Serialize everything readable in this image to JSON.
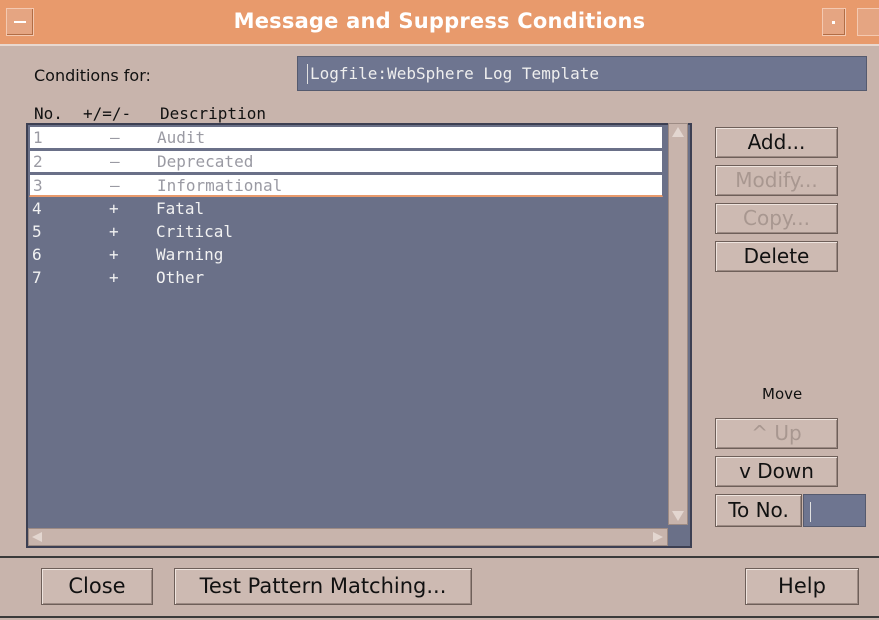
{
  "window": {
    "title": "Message and Suppress Conditions",
    "title_color": "#e89a6c",
    "background_color": "#c8b4ac"
  },
  "conditions": {
    "label": "Conditions for:",
    "value": "Logfile:WebSphere Log Template"
  },
  "list": {
    "headers": [
      "No.",
      "+/=/-",
      "Description"
    ],
    "rows": [
      {
        "no": "1",
        "op": "–",
        "desc": "Audit",
        "selected": true
      },
      {
        "no": "2",
        "op": "–",
        "desc": "Deprecated",
        "selected": true
      },
      {
        "no": "3",
        "op": "–",
        "desc": "Informational",
        "selected": true
      },
      {
        "no": "4",
        "op": "+",
        "desc": "Fatal",
        "selected": false
      },
      {
        "no": "5",
        "op": "+",
        "desc": "Critical",
        "selected": false
      },
      {
        "no": "6",
        "op": "+",
        "desc": "Warning",
        "selected": false
      },
      {
        "no": "7",
        "op": "+",
        "desc": "Other",
        "selected": false
      }
    ]
  },
  "side_buttons": {
    "add": "Add...",
    "modify": "Modify...",
    "copy": "Copy...",
    "delete": "Delete"
  },
  "move": {
    "label": "Move",
    "up": "^  Up",
    "down": "v Down",
    "to_no": "To No."
  },
  "bottom_buttons": {
    "close": "Close",
    "test_pattern": "Test Pattern Matching...",
    "help": "Help"
  }
}
